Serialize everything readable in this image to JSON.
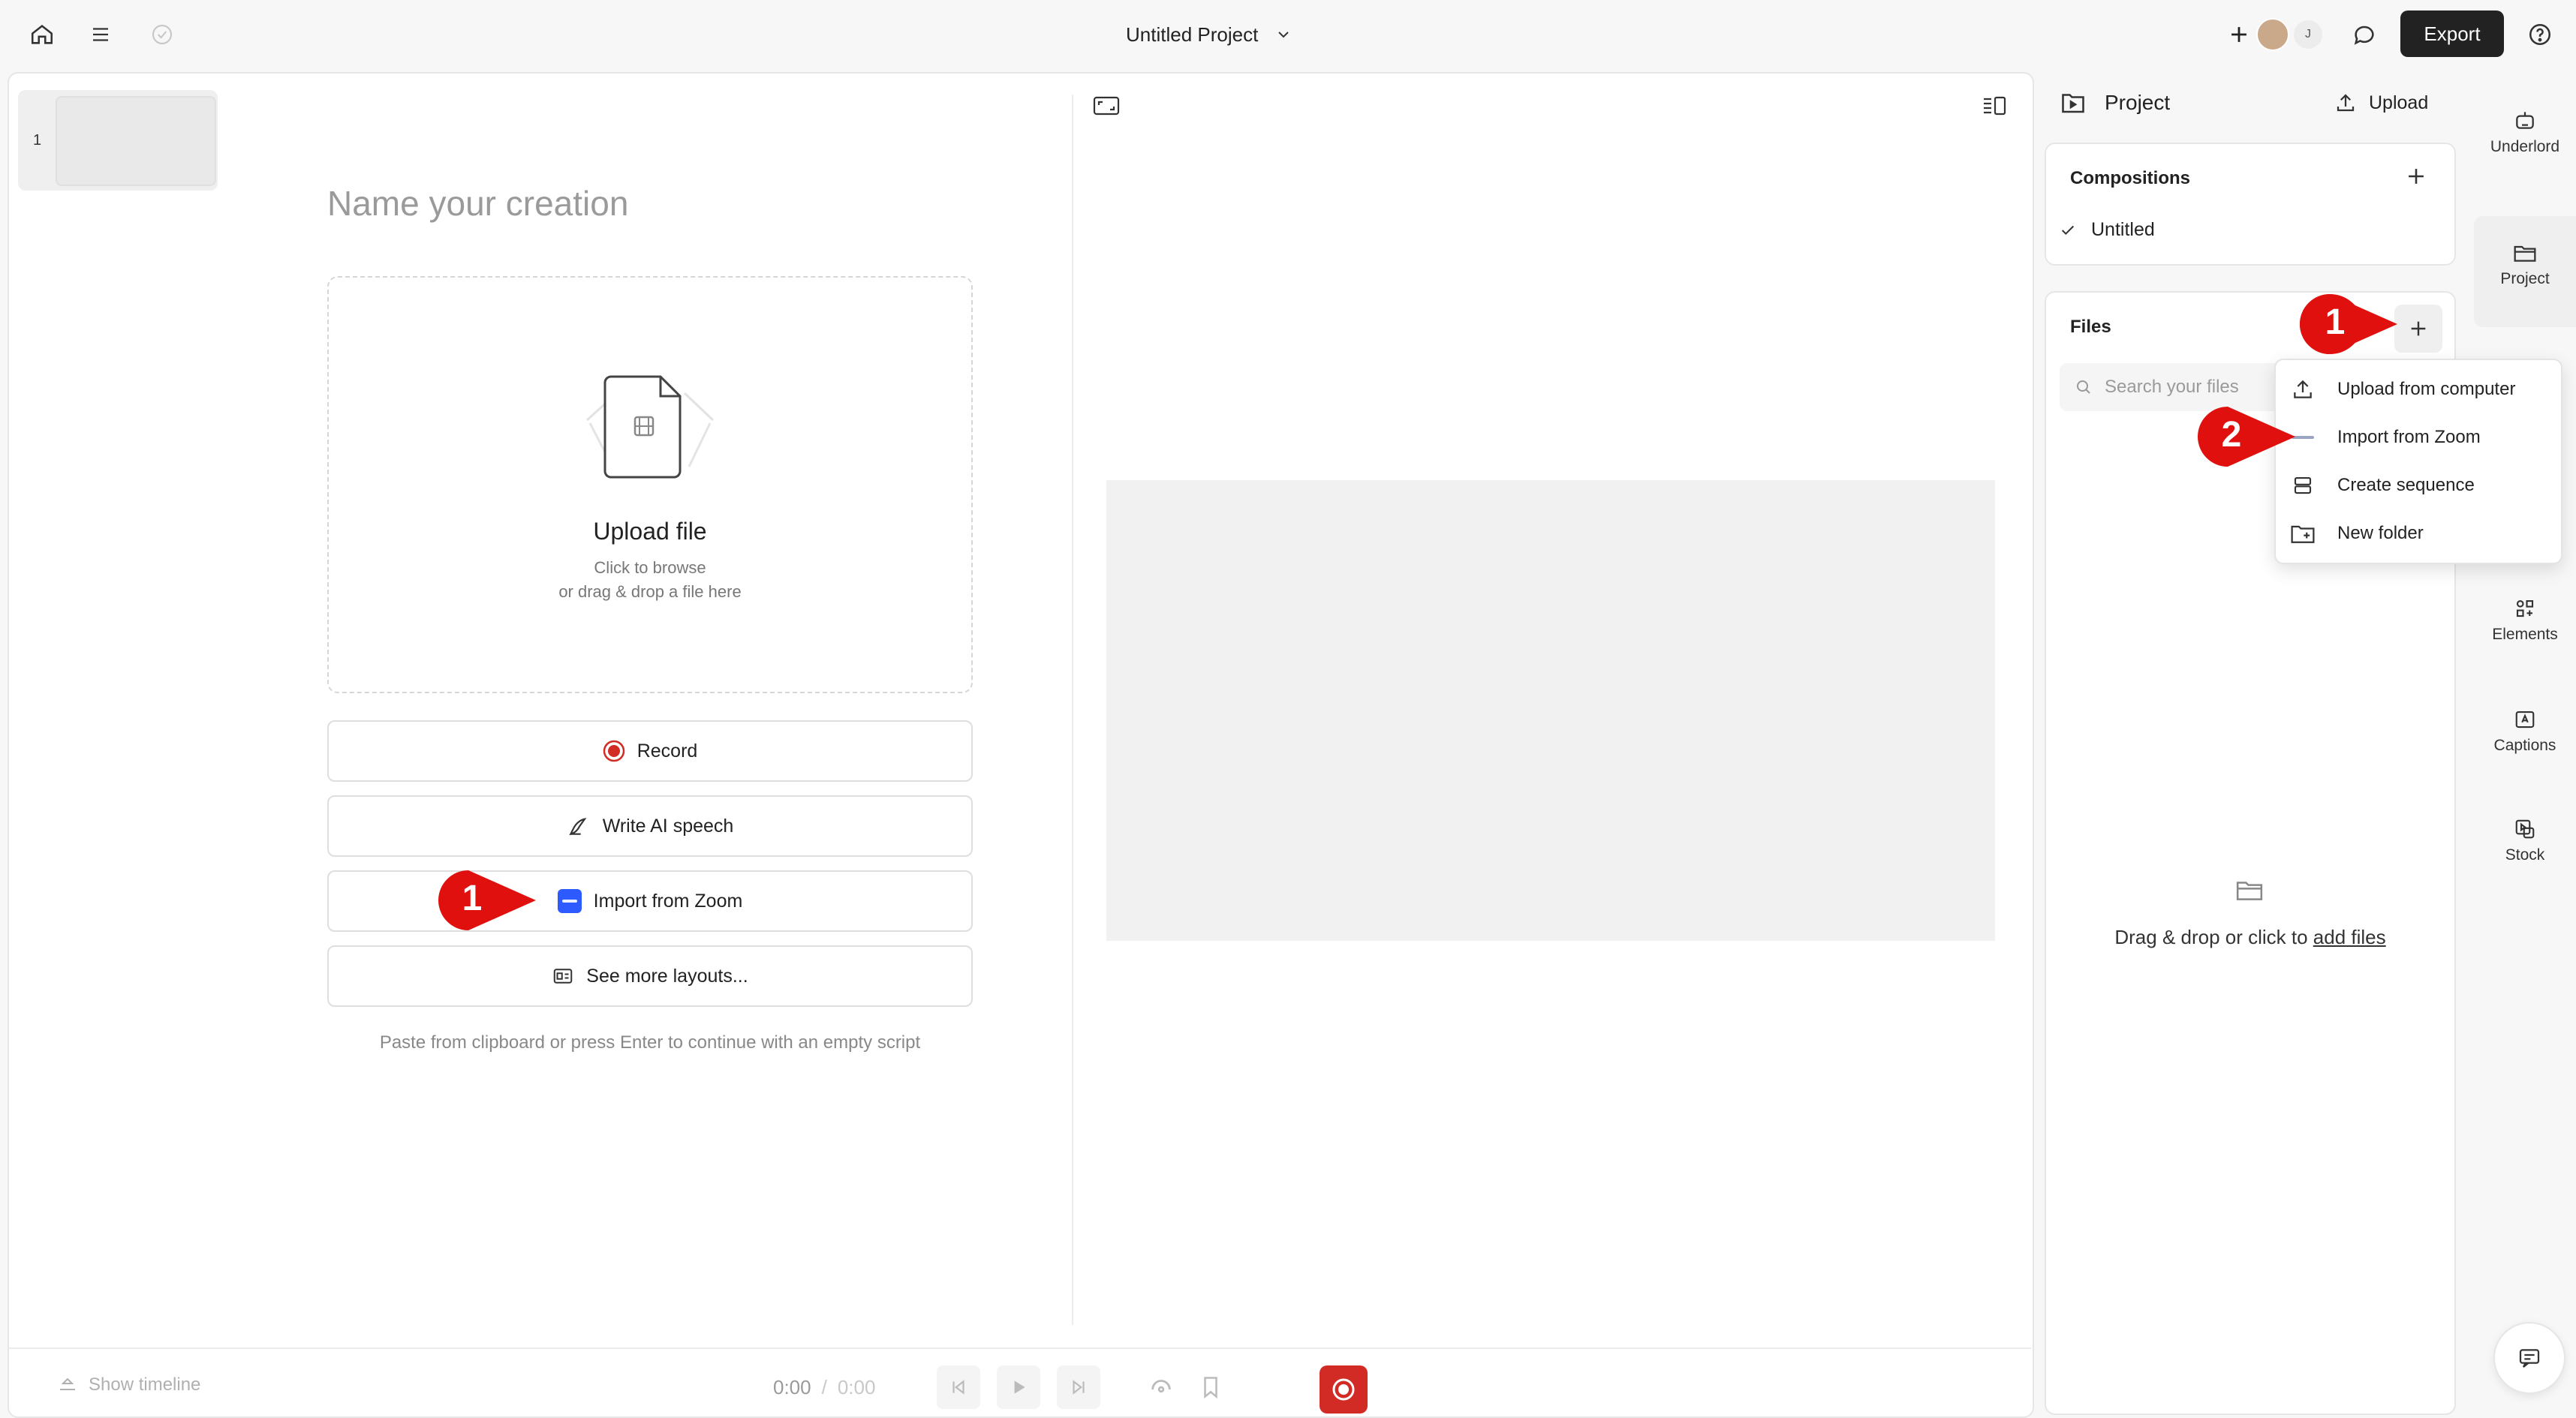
{
  "topbar": {
    "project_title": "Untitled Project",
    "avatar_initial": "J",
    "export_label": "Export"
  },
  "scenes": {
    "first_number": "1"
  },
  "editor": {
    "name_placeholder": "Name your creation",
    "upload_title": "Upload file",
    "upload_sub1": "Click to browse",
    "upload_sub2": "or drag & drop a file here",
    "record_label": "Record",
    "ai_speech_label": "Write AI speech",
    "zoom_label": "Import from Zoom",
    "layouts_label": "See more layouts...",
    "hint": "Paste from clipboard or press Enter to continue with an empty script"
  },
  "transport": {
    "show_timeline": "Show timeline",
    "current_time": "0:00",
    "separator": "/",
    "total_time": "0:00"
  },
  "project_panel": {
    "title": "Project",
    "upload_label": "Upload",
    "compositions_label": "Compositions",
    "composition_item": "Untitled",
    "files_label": "Files",
    "search_placeholder": "Search your files",
    "empty_text": "Drag & drop or click to ",
    "empty_link": "add files"
  },
  "files_menu": {
    "items": [
      "Upload from computer",
      "Import from Zoom",
      "Create sequence",
      "New folder"
    ]
  },
  "rail": {
    "items": [
      "Underlord",
      "Project",
      "Elements",
      "Captions",
      "Stock"
    ]
  },
  "annotations": {
    "badge_plus": "1",
    "badge_menu": "2",
    "badge_zoom": "1",
    "color": "#e0100f"
  },
  "colors": {
    "accent_red": "#d22b25",
    "zoom_blue": "#2d5bff",
    "dark_button": "#222222"
  }
}
